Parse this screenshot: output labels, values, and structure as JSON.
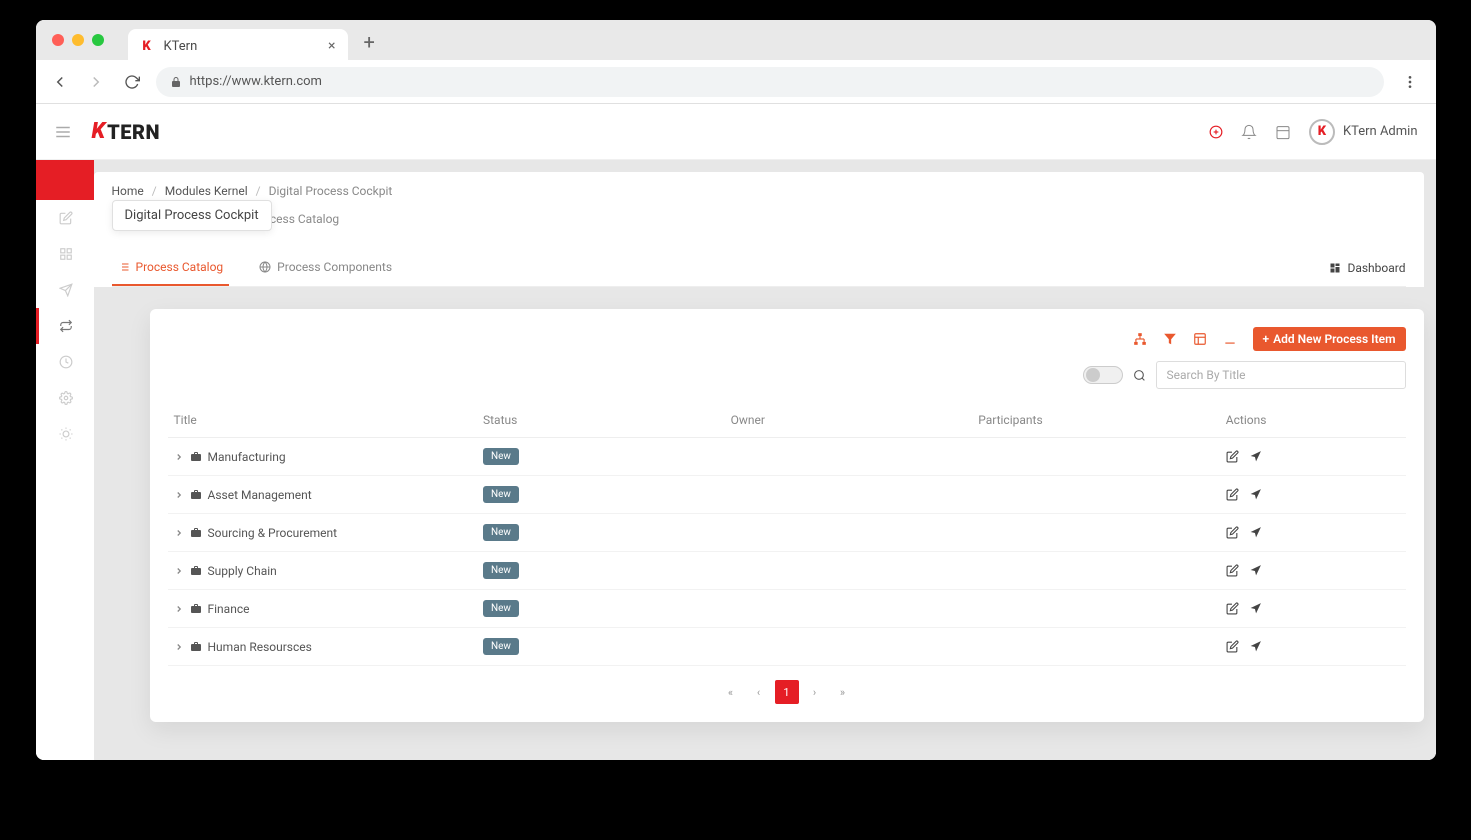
{
  "browser": {
    "tab_title": "KTern",
    "url": "https://www.ktern.com"
  },
  "header": {
    "logo_k": "K",
    "logo_rest": "TERN",
    "user_name": "KTern Admin",
    "user_initial": "K"
  },
  "breadcrumb": {
    "home": "Home",
    "modules": "Modules Kernel",
    "current": "Digital Process Cockpit"
  },
  "tooltip": "Digital Process Cockpit",
  "page_subtitle": "Process Catalog",
  "tabs": {
    "catalog": "Process Catalog",
    "components": "Process Components",
    "dashboard": "Dashboard"
  },
  "toolbar": {
    "add_button": "Add New Process Item"
  },
  "search": {
    "placeholder": "Search By Title"
  },
  "columns": {
    "title": "Title",
    "status": "Status",
    "owner": "Owner",
    "participants": "Participants",
    "actions": "Actions"
  },
  "rows": [
    {
      "title": "Manufacturing",
      "status": "New"
    },
    {
      "title": "Asset Management",
      "status": "New"
    },
    {
      "title": "Sourcing & Procurement",
      "status": "New"
    },
    {
      "title": "Supply Chain",
      "status": "New"
    },
    {
      "title": "Finance",
      "status": "New"
    },
    {
      "title": "Human Resoursces",
      "status": "New"
    }
  ],
  "pagination": {
    "current": "1"
  }
}
